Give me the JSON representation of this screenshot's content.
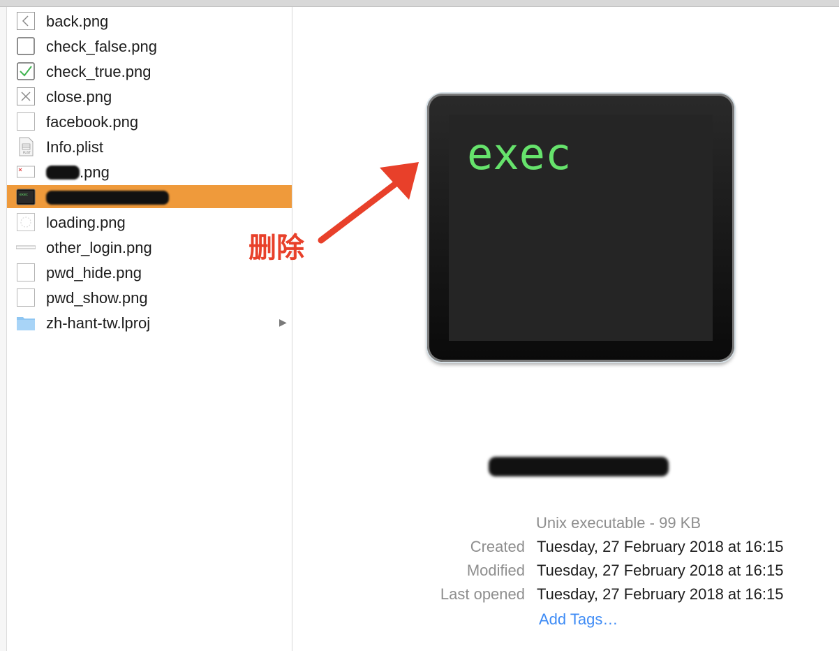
{
  "files": [
    {
      "label": "back.png",
      "icon": "back-icon"
    },
    {
      "label": "check_false.png",
      "icon": "checkbox-empty-icon"
    },
    {
      "label": "check_true.png",
      "icon": "checkbox-checked-icon"
    },
    {
      "label": "close.png",
      "icon": "close-icon"
    },
    {
      "label": "facebook.png",
      "icon": "blank-image-icon"
    },
    {
      "label": "Info.plist",
      "icon": "plist-file-icon"
    },
    {
      "label": ".png",
      "icon": "image-file-icon"
    },
    {
      "label": "",
      "icon": "exec-file-icon"
    },
    {
      "label": "loading.png",
      "icon": "loading-image-icon"
    },
    {
      "label": "other_login.png",
      "icon": "line-image-icon"
    },
    {
      "label": "pwd_hide.png",
      "icon": "blank-image-icon"
    },
    {
      "label": "pwd_show.png",
      "icon": "blank-image-icon"
    },
    {
      "label": "zh-hant-tw.lproj",
      "icon": "folder-icon"
    }
  ],
  "disclosure": "▶",
  "annotation": {
    "text": "删除",
    "color": "#e8402a"
  },
  "preview": {
    "icon_text": "exec",
    "text_color": "#66e36c"
  },
  "info": {
    "kind": "Unix executable - 99 KB",
    "created_label": "Created",
    "created_value": "Tuesday, 27 February 2018 at 16:15",
    "modified_label": "Modified",
    "modified_value": "Tuesday, 27 February 2018 at 16:15",
    "opened_label": "Last opened",
    "opened_value": "Tuesday, 27 February 2018 at 16:15",
    "add_tags": "Add Tags…"
  },
  "colors": {
    "selection": "#ef9a3b",
    "link": "#3e8bf5"
  }
}
